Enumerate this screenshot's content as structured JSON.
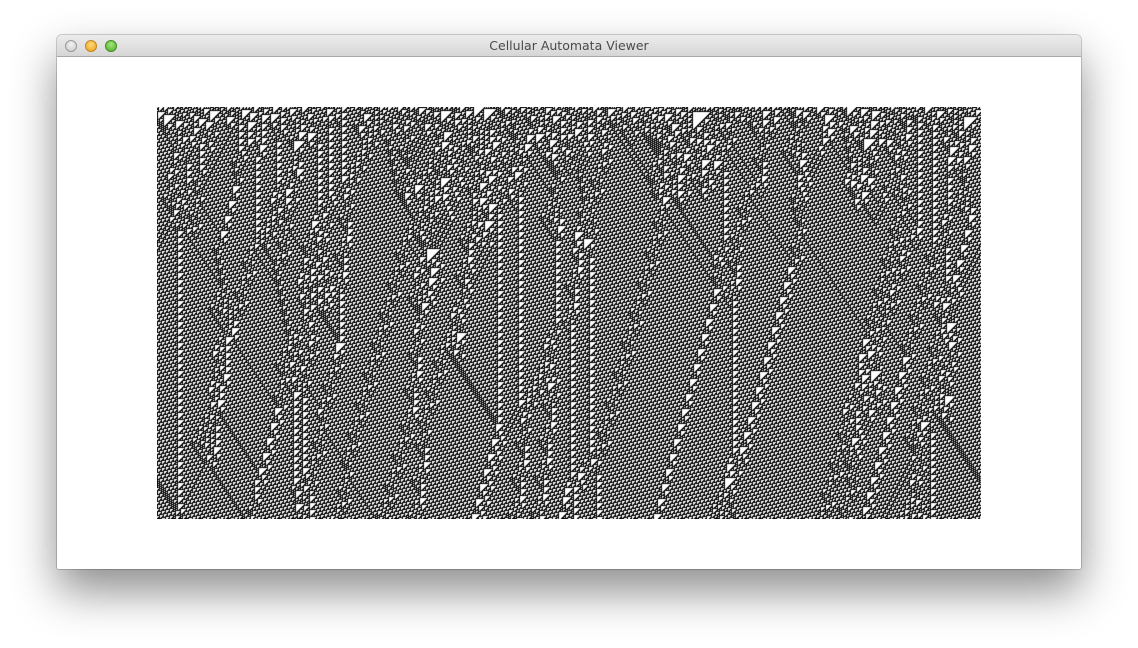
{
  "window": {
    "title": "Cellular Automata Viewer"
  },
  "controls": {
    "close_icon": "close-icon",
    "minimize_icon": "minimize-icon",
    "zoom_icon": "zoom-icon"
  },
  "automaton": {
    "alive_color": "#000000",
    "dead_color": "#ffffff"
  }
}
